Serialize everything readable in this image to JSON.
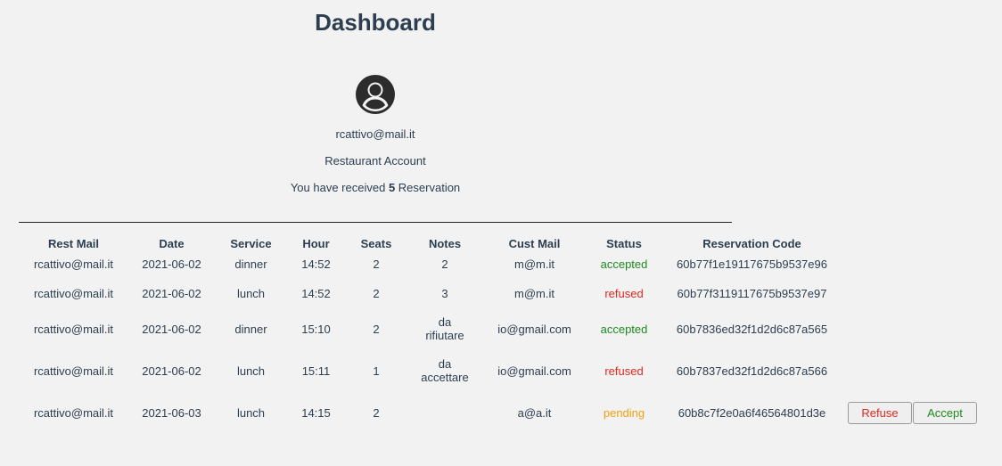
{
  "header": {
    "title": "Dashboard"
  },
  "profile": {
    "email": "rcattivo@mail.it",
    "account_type": "Restaurant Account",
    "received_prefix": "You have received",
    "received_count": "5",
    "received_suffix": "Reservation"
  },
  "table": {
    "columns": [
      "Rest Mail",
      "Date",
      "Service",
      "Hour",
      "Seats",
      "Notes",
      "Cust Mail",
      "Status",
      "Reservation Code"
    ],
    "rows": [
      {
        "rest_mail": "rcattivo@mail.it",
        "date": "2021-06-02",
        "service": "dinner",
        "hour": "14:52",
        "seats": "2",
        "notes": "2",
        "cust_mail": "m@m.it",
        "status": "accepted",
        "code": "60b77f1e19117675b9537e96"
      },
      {
        "rest_mail": "rcattivo@mail.it",
        "date": "2021-06-02",
        "service": "lunch",
        "hour": "14:52",
        "seats": "2",
        "notes": "3",
        "cust_mail": "m@m.it",
        "status": "refused",
        "code": "60b77f3119117675b9537e97"
      },
      {
        "rest_mail": "rcattivo@mail.it",
        "date": "2021-06-02",
        "service": "dinner",
        "hour": "15:10",
        "seats": "2",
        "notes": "da rifiutare",
        "cust_mail": "io@gmail.com",
        "status": "accepted",
        "code": "60b7836ed32f1d2d6c87a565"
      },
      {
        "rest_mail": "rcattivo@mail.it",
        "date": "2021-06-02",
        "service": "lunch",
        "hour": "15:11",
        "seats": "1",
        "notes": "da accettare",
        "cust_mail": "io@gmail.com",
        "status": "refused",
        "code": "60b7837ed32f1d2d6c87a566"
      },
      {
        "rest_mail": "rcattivo@mail.it",
        "date": "2021-06-03",
        "service": "lunch",
        "hour": "14:15",
        "seats": "2",
        "notes": "",
        "cust_mail": "a@a.it",
        "status": "pending",
        "code": "60b8c7f2e0a6f46564801d3e"
      }
    ]
  },
  "actions": {
    "refuse_label": "Refuse",
    "accept_label": "Accept"
  },
  "colors": {
    "accepted": "#1e8a1e",
    "refused": "#e0281e",
    "pending": "#f0a010",
    "heading": "#2c3e50"
  },
  "icons": {
    "avatar": "user-circle-icon"
  }
}
